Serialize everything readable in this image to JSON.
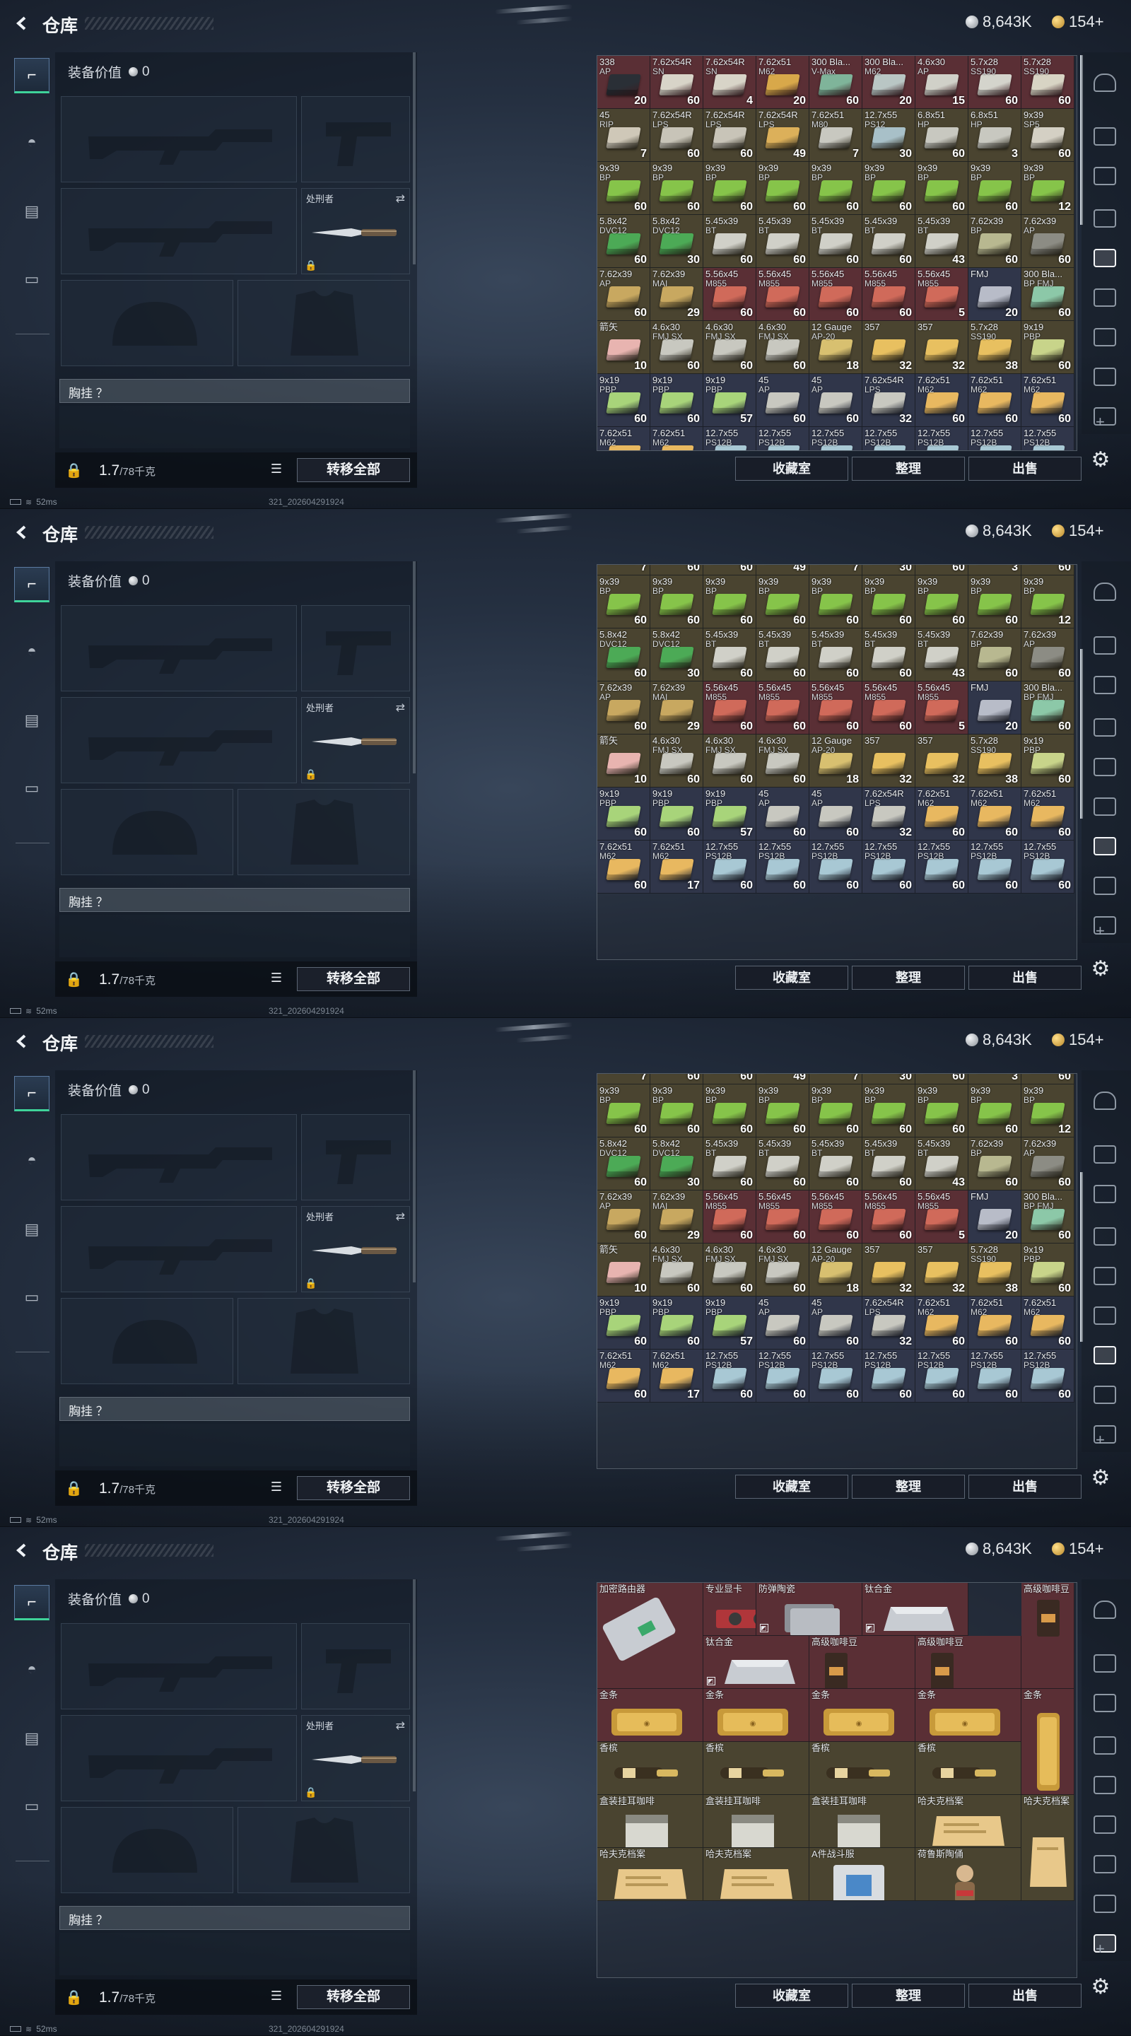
{
  "header": {
    "title": "仓库",
    "silver": "8,643K",
    "gold": "154+"
  },
  "left_nav": [
    {
      "icon": "pistol-icon",
      "active": true
    },
    {
      "icon": "helmet-icon",
      "active": false
    },
    {
      "icon": "vest-icon",
      "active": false
    },
    {
      "icon": "briefcase-icon",
      "active": false
    }
  ],
  "equipment": {
    "value_label": "装备价值",
    "value": "0",
    "melee_label": "处刑者",
    "chest_label": "胸挂 ？",
    "weight": "1.7",
    "weight_max": "/78千克",
    "move_all": "转移全部"
  },
  "buttons": {
    "favorites": "收藏室",
    "sort": "整理",
    "sell": "出售"
  },
  "status": {
    "ping": "52ms",
    "stamp": "321_202604291924"
  },
  "colors": {
    "grid_red": "#5a2f35",
    "grid_olive": "#4a4430",
    "grid_blue": "#30364a",
    "accent_green": "#3fd39a"
  },
  "ammo_rows": [
    [
      [
        "338",
        "AP",
        "20",
        "red",
        "#2a2f36"
      ],
      [
        "7.62x54R",
        "SN",
        "60",
        "red",
        "#d8d4c8"
      ],
      [
        "7.62x54R",
        "SN",
        "4",
        "red",
        "#d8d4c8"
      ],
      [
        "7.62x51",
        "M62",
        "20",
        "red",
        "#d8a84a"
      ],
      [
        "300 Bla...",
        "V-Max",
        "60",
        "red",
        "#7fb49a"
      ],
      [
        "300 Bla...",
        "M62",
        "20",
        "red",
        "#b9c6c4"
      ],
      [
        "4.6x30",
        "AP",
        "15",
        "red",
        "#d0d0c8"
      ],
      [
        "5.7x28",
        "SS190",
        "60",
        "red",
        "#d4d4cc"
      ],
      [
        "5.7x28",
        "SS190",
        "60",
        "red",
        "#d8d4c4"
      ]
    ],
    [
      [
        "45",
        "RIP",
        "7",
        "olive",
        "#cfc8b8"
      ],
      [
        "7.62x54R",
        "LPS",
        "60",
        "olive",
        "#c8c4b8"
      ],
      [
        "7.62x54R",
        "LPS",
        "60",
        "olive",
        "#c8c4b8"
      ],
      [
        "7.62x54R",
        "LPS",
        "49",
        "olive",
        "#dcb05a"
      ],
      [
        "7.62x51",
        "M80",
        "7",
        "olive",
        "#c8c8c0"
      ],
      [
        "12.7x55",
        "PS12",
        "30",
        "olive",
        "#a8c0c8"
      ],
      [
        "6.8x51",
        "HP",
        "60",
        "olive",
        "#c8c8c0"
      ],
      [
        "6.8x51",
        "HP",
        "3",
        "olive",
        "#c8c8c0"
      ],
      [
        "9x39",
        "SP5",
        "60",
        "olive",
        "#d4d0c4"
      ]
    ],
    [
      [
        "9x39",
        "BP",
        "60",
        "olive",
        "#86c44a"
      ],
      [
        "9x39",
        "BP",
        "60",
        "olive",
        "#86c44a"
      ],
      [
        "9x39",
        "BP",
        "60",
        "olive",
        "#86c44a"
      ],
      [
        "9x39",
        "BP",
        "60",
        "olive",
        "#86c44a"
      ],
      [
        "9x39",
        "BP",
        "60",
        "olive",
        "#86c44a"
      ],
      [
        "9x39",
        "BP",
        "60",
        "olive",
        "#86c44a"
      ],
      [
        "9x39",
        "BP",
        "60",
        "olive",
        "#86c44a"
      ],
      [
        "9x39",
        "BP",
        "60",
        "olive",
        "#86c44a"
      ],
      [
        "9x39",
        "BP",
        "12",
        "olive",
        "#86c44a"
      ]
    ],
    [
      [
        "5.8x42",
        "DVC12",
        "60",
        "olive",
        "#4caa56"
      ],
      [
        "5.8x42",
        "DVC12",
        "30",
        "olive",
        "#4caa56"
      ],
      [
        "5.45x39",
        "BT",
        "60",
        "olive",
        "#d0d0c8"
      ],
      [
        "5.45x39",
        "BT",
        "60",
        "olive",
        "#d0d0c8"
      ],
      [
        "5.45x39",
        "BT",
        "60",
        "olive",
        "#d0d0c8"
      ],
      [
        "5.45x39",
        "BT",
        "60",
        "olive",
        "#d0d0c8"
      ],
      [
        "5.45x39",
        "BT",
        "43",
        "olive",
        "#d0d0c8"
      ],
      [
        "7.62x39",
        "BP",
        "60",
        "olive",
        "#b8b890"
      ],
      [
        "7.62x39",
        "AP",
        "60",
        "olive",
        "#8c8c84"
      ]
    ],
    [
      [
        "7.62x39",
        "AP",
        "60",
        "olive",
        "#c8a860"
      ],
      [
        "7.62x39",
        "MAI",
        "29",
        "olive",
        "#c8a860"
      ],
      [
        "5.56x45",
        "M855",
        "60",
        "red",
        "#d06a5a"
      ],
      [
        "5.56x45",
        "M855",
        "60",
        "red",
        "#d06a5a"
      ],
      [
        "5.56x45",
        "M855",
        "60",
        "red",
        "#d06a5a"
      ],
      [
        "5.56x45",
        "M855",
        "60",
        "red",
        "#d06a5a"
      ],
      [
        "5.56x45",
        "M855",
        "5",
        "red",
        "#d06a5a"
      ],
      [
        "FMJ",
        "",
        "20",
        "blue",
        "#b8bcc8"
      ],
      [
        "300 Bla...",
        "BP FMJ",
        "60",
        "olive",
        "#8cc8a8"
      ]
    ],
    [
      [
        "箭矢",
        "",
        "10",
        "olive",
        "#e8b4b0"
      ],
      [
        "4.6x30",
        "FMJ SX",
        "60",
        "olive",
        "#c8c8c0"
      ],
      [
        "4.6x30",
        "FMJ SX",
        "60",
        "olive",
        "#c8c8c0"
      ],
      [
        "4.6x30",
        "FMJ SX",
        "60",
        "olive",
        "#c8c8c0"
      ],
      [
        "12 Gauge",
        "AP-20",
        "18",
        "olive",
        "#d8c070"
      ],
      [
        "357",
        "",
        "32",
        "olive",
        "#e8c060"
      ],
      [
        "357",
        "",
        "32",
        "olive",
        "#e8c060"
      ],
      [
        "5.7x28",
        "SS190",
        "38",
        "olive",
        "#e8c060"
      ],
      [
        "9x19",
        "PBP",
        "60",
        "olive",
        "#c8d48a"
      ]
    ],
    [
      [
        "9x19",
        "PBP",
        "60",
        "blue",
        "#a8d47a"
      ],
      [
        "9x19",
        "PBP",
        "60",
        "blue",
        "#a8d47a"
      ],
      [
        "9x19",
        "PBP",
        "57",
        "blue",
        "#a8d47a"
      ],
      [
        "45",
        "AP",
        "60",
        "blue",
        "#c8c8c0"
      ],
      [
        "45",
        "AP",
        "60",
        "blue",
        "#c8c8c0"
      ],
      [
        "7.62x54R",
        "LPS",
        "32",
        "blue",
        "#c8c8c0"
      ],
      [
        "7.62x51",
        "M62",
        "60",
        "blue",
        "#e8b860"
      ],
      [
        "7.62x51",
        "M62",
        "60",
        "blue",
        "#e8b860"
      ],
      [
        "7.62x51",
        "M62",
        "60",
        "blue",
        "#e8b860"
      ]
    ],
    [
      [
        "7.62x51",
        "M62",
        "60",
        "blue",
        "#e8b860"
      ],
      [
        "7.62x51",
        "M62",
        "17",
        "blue",
        "#e8b860"
      ],
      [
        "12.7x55",
        "PS12B",
        "60",
        "blue",
        "#a8c8d4"
      ],
      [
        "12.7x55",
        "PS12B",
        "60",
        "blue",
        "#a8c8d4"
      ],
      [
        "12.7x55",
        "PS12B",
        "60",
        "blue",
        "#a8c8d4"
      ],
      [
        "12.7x55",
        "PS12B",
        "60",
        "blue",
        "#a8c8d4"
      ],
      [
        "12.7x55",
        "PS12B",
        "60",
        "blue",
        "#a8c8d4"
      ],
      [
        "12.7x55",
        "PS12B",
        "60",
        "blue",
        "#a8c8d4"
      ],
      [
        "12.7x55",
        "PS12B",
        "60",
        "blue",
        "#a8c8d4"
      ]
    ]
  ],
  "loot_items": [
    {
      "name": "加密路由器",
      "tint": "red",
      "img": "router"
    },
    {
      "name": "专业显卡",
      "tint": "red",
      "img": "gpu"
    },
    {
      "name": "防弹陶瓷",
      "tint": "red",
      "img": "plate"
    },
    {
      "name": "钛合金",
      "tint": "red",
      "img": "ingot"
    },
    {
      "name": "高级咖啡豆",
      "tint": "red",
      "img": "coffee"
    },
    {
      "name": "钛合金",
      "tint": "red",
      "img": "ingot"
    },
    {
      "name": "高级咖啡豆",
      "tint": "red",
      "img": "coffee"
    },
    {
      "name": "高级咖啡豆",
      "tint": "red",
      "img": "coffee"
    },
    {
      "name": "金条",
      "tint": "red",
      "img": "gold"
    },
    {
      "name": "金条",
      "tint": "red",
      "img": "gold"
    },
    {
      "name": "金条",
      "tint": "red",
      "img": "gold"
    },
    {
      "name": "金条",
      "tint": "red",
      "img": "gold"
    },
    {
      "name": "金条",
      "tint": "red",
      "img": "goldv"
    },
    {
      "name": "香槟",
      "tint": "olive",
      "img": "wine"
    },
    {
      "name": "香槟",
      "tint": "olive",
      "img": "wine"
    },
    {
      "name": "香槟",
      "tint": "olive",
      "img": "wine"
    },
    {
      "name": "香槟",
      "tint": "olive",
      "img": "wine"
    },
    {
      "name": "盒装挂耳咖啡",
      "tint": "olive",
      "img": "box"
    },
    {
      "name": "盒装挂耳咖啡",
      "tint": "olive",
      "img": "box"
    },
    {
      "name": "盒装挂耳咖啡",
      "tint": "olive",
      "img": "box"
    },
    {
      "name": "哈夫克档案",
      "tint": "olive",
      "img": "docs"
    },
    {
      "name": "哈夫克档案",
      "tint": "olive",
      "img": "docsv"
    },
    {
      "name": "哈夫克档案",
      "tint": "olive",
      "img": "docs"
    },
    {
      "name": "哈夫克档案",
      "tint": "olive",
      "img": "docs"
    },
    {
      "name": "A件战斗服",
      "tint": "olive",
      "img": "gear"
    },
    {
      "name": "荷鲁斯陶俑",
      "tint": "olive",
      "img": "figure"
    }
  ]
}
